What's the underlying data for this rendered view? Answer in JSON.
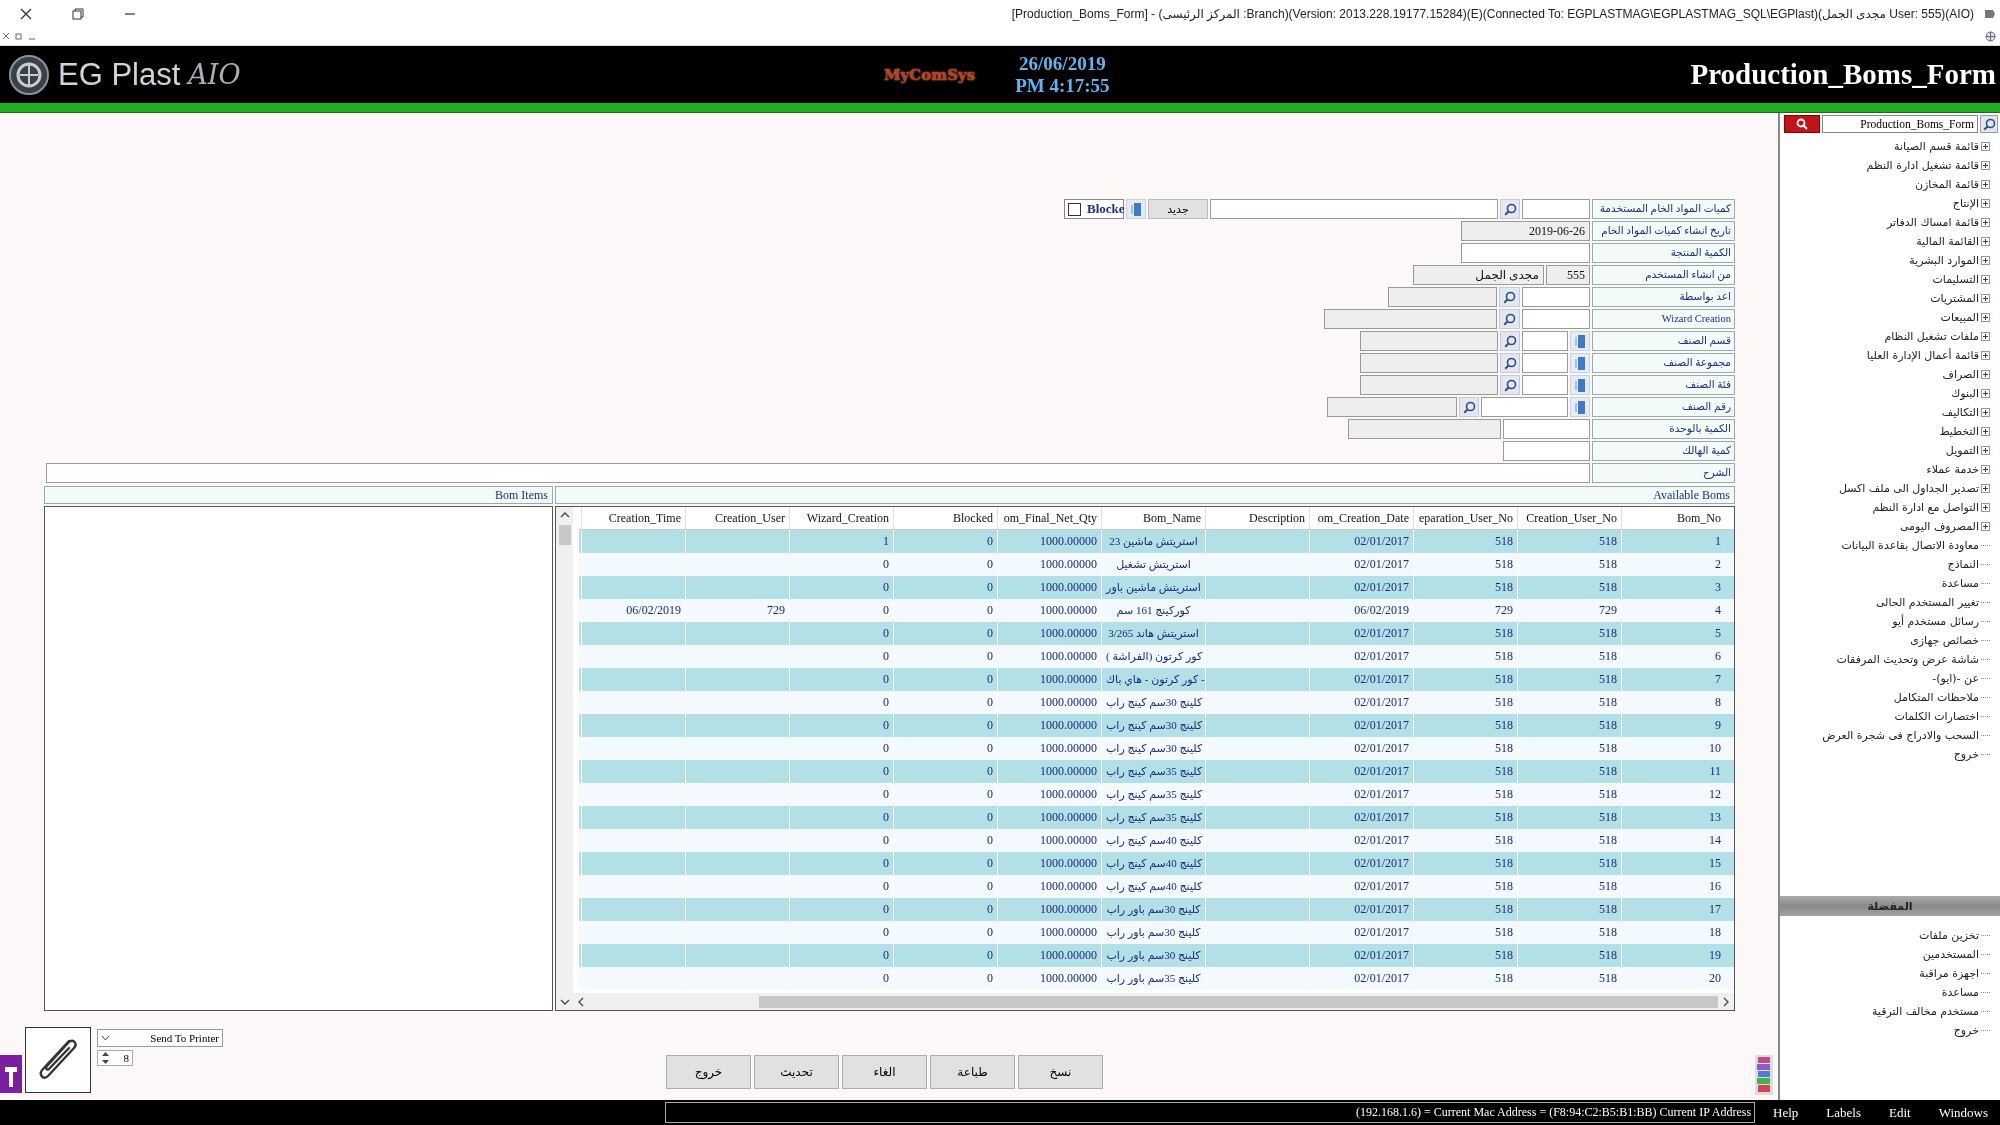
{
  "window": {
    "title": "[Production_Boms_Form] - (المركز الرئيسى :Branch)(Version: 2013.228.19177.15284)(E)(Connected To: EGPLASTMAG\\EGPLASTMAG_SQL\\EGPlast)(مجدى الجمل User: 555)(AIO)"
  },
  "header": {
    "logo_text": "EG Plast",
    "logo_suffix": "AIO",
    "vendor": "MyComSys",
    "date": "26/06/2019",
    "time": "PM 4:17:55",
    "form_title": "Production_Boms_Form"
  },
  "form": {
    "rows": [
      {
        "label": "كميات المواد الخام المستخدمة",
        "controls": [
          {
            "kind": "field",
            "disabled": false
          },
          {
            "kind": "search"
          },
          {
            "kind": "field",
            "disabled": false
          },
          {
            "kind": "new",
            "label": "جديد"
          },
          {
            "kind": "picker"
          },
          {
            "kind": "checkbox",
            "label": "Blocke",
            "checked": false
          }
        ]
      },
      {
        "label": "تاريخ انشاء كميات المواد الخام",
        "controls": [
          {
            "kind": "field",
            "disabled": true,
            "value": "2019-06-26"
          }
        ]
      },
      {
        "label": "الكمية المنتجة",
        "controls": [
          {
            "kind": "field",
            "disabled": false
          }
        ]
      },
      {
        "label": "من انشاء المستخدم",
        "controls": [
          {
            "kind": "field",
            "disabled": true,
            "value": "555"
          },
          {
            "kind": "field",
            "disabled": true,
            "value": "مجدى الجمل"
          }
        ]
      },
      {
        "label": "اعد بواسطة",
        "controls": [
          {
            "kind": "field",
            "disabled": false
          },
          {
            "kind": "search"
          },
          {
            "kind": "field",
            "disabled": true
          }
        ]
      },
      {
        "label": "Wizard Creation",
        "controls": [
          {
            "kind": "field",
            "disabled": false
          },
          {
            "kind": "search"
          },
          {
            "kind": "field",
            "disabled": true
          }
        ]
      },
      {
        "label": "قسم الصنف",
        "controls": [
          {
            "kind": "picker"
          },
          {
            "kind": "field",
            "disabled": false
          },
          {
            "kind": "search"
          },
          {
            "kind": "field",
            "disabled": true
          }
        ]
      },
      {
        "label": "مجموعة الصنف",
        "controls": [
          {
            "kind": "picker"
          },
          {
            "kind": "field",
            "disabled": false
          },
          {
            "kind": "search"
          },
          {
            "kind": "field",
            "disabled": true
          }
        ]
      },
      {
        "label": "فئة الصنف",
        "controls": [
          {
            "kind": "picker"
          },
          {
            "kind": "field",
            "disabled": false
          },
          {
            "kind": "search"
          },
          {
            "kind": "field",
            "disabled": true
          }
        ]
      },
      {
        "label": "رقم الصنف",
        "controls": [
          {
            "kind": "picker"
          },
          {
            "kind": "field",
            "disabled": false
          },
          {
            "kind": "search"
          },
          {
            "kind": "field",
            "disabled": true
          }
        ]
      },
      {
        "label": "الكمية بالوحدة",
        "controls": [
          {
            "kind": "field",
            "disabled": false
          },
          {
            "kind": "field",
            "disabled": true
          }
        ]
      },
      {
        "label": "كمية الهالك",
        "controls": [
          {
            "kind": "field",
            "disabled": false
          }
        ]
      },
      {
        "label": "الشرح",
        "controls": [
          {
            "kind": "field",
            "disabled": false
          }
        ]
      }
    ]
  },
  "bom_items": {
    "title": "Bom Items"
  },
  "available_boms": {
    "title": "Available Boms",
    "columns": [
      "Bom_No",
      "Creation_User_No",
      "eparation_User_No",
      "om_Creation_Date",
      "Description",
      "Bom_Name",
      "om_Final_Net_Qty",
      "Blocked",
      "Wizard_Creation",
      "Creation_User",
      "Creation_Time"
    ],
    "rows": [
      {
        "bom_no": "1",
        "creation_user_no": "518",
        "preparation_user_no": "518",
        "creation_date": "02/01/2017",
        "bom_name": "استريتش ماشين 23",
        "final_net_qty": "1000.00000",
        "blocked": "0",
        "wizard_creation": "1"
      },
      {
        "bom_no": "2",
        "creation_user_no": "518",
        "preparation_user_no": "518",
        "creation_date": "02/01/2017",
        "bom_name": "استريتش تشغيل",
        "final_net_qty": "1000.00000",
        "blocked": "0",
        "wizard_creation": "0"
      },
      {
        "bom_no": "3",
        "creation_user_no": "518",
        "preparation_user_no": "518",
        "creation_date": "02/01/2017",
        "bom_name": "استريتش ماشين باور",
        "final_net_qty": "1000.00000",
        "blocked": "0",
        "wizard_creation": "0"
      },
      {
        "bom_no": "4",
        "creation_user_no": "729",
        "preparation_user_no": "729",
        "creation_date": "06/02/2019",
        "bom_name": "كوركينج 161 سم",
        "final_net_qty": "1000.00000",
        "blocked": "0",
        "wizard_creation": "0",
        "creation_user": "729",
        "creation_time": "06/02/2019"
      },
      {
        "bom_no": "5",
        "creation_user_no": "518",
        "preparation_user_no": "518",
        "creation_date": "02/01/2017",
        "bom_name": "استريتش هاند 3/265",
        "final_net_qty": "1000.00000",
        "blocked": "0",
        "wizard_creation": "0"
      },
      {
        "bom_no": "6",
        "creation_user_no": "518",
        "preparation_user_no": "518",
        "creation_date": "02/01/2017",
        "bom_name": "كور كرتون (الفراشة )",
        "final_net_qty": "1000.00000",
        "blocked": "0",
        "wizard_creation": "0"
      },
      {
        "bom_no": "7",
        "creation_user_no": "518",
        "preparation_user_no": "518",
        "creation_date": "02/01/2017",
        "bom_name": "كور كرتون - هاي باك -",
        "final_net_qty": "1000.00000",
        "blocked": "0",
        "wizard_creation": "0"
      },
      {
        "bom_no": "8",
        "creation_user_no": "518",
        "preparation_user_no": "518",
        "creation_date": "02/01/2017",
        "bom_name": "كلينج 30سم كينج راب",
        "final_net_qty": "1000.00000",
        "blocked": "0",
        "wizard_creation": "0"
      },
      {
        "bom_no": "9",
        "creation_user_no": "518",
        "preparation_user_no": "518",
        "creation_date": "02/01/2017",
        "bom_name": "كلينج 30سم كينج راب",
        "final_net_qty": "1000.00000",
        "blocked": "0",
        "wizard_creation": "0"
      },
      {
        "bom_no": "10",
        "creation_user_no": "518",
        "preparation_user_no": "518",
        "creation_date": "02/01/2017",
        "bom_name": "كلينج 30سم كينج راب",
        "final_net_qty": "1000.00000",
        "blocked": "0",
        "wizard_creation": "0"
      },
      {
        "bom_no": "11",
        "creation_user_no": "518",
        "preparation_user_no": "518",
        "creation_date": "02/01/2017",
        "bom_name": "كلينج 35سم كينج راب",
        "final_net_qty": "1000.00000",
        "blocked": "0",
        "wizard_creation": "0"
      },
      {
        "bom_no": "12",
        "creation_user_no": "518",
        "preparation_user_no": "518",
        "creation_date": "02/01/2017",
        "bom_name": "كلينج 35سم كينج راب",
        "final_net_qty": "1000.00000",
        "blocked": "0",
        "wizard_creation": "0"
      },
      {
        "bom_no": "13",
        "creation_user_no": "518",
        "preparation_user_no": "518",
        "creation_date": "02/01/2017",
        "bom_name": "كلينج 35سم كينج راب",
        "final_net_qty": "1000.00000",
        "blocked": "0",
        "wizard_creation": "0"
      },
      {
        "bom_no": "14",
        "creation_user_no": "518",
        "preparation_user_no": "518",
        "creation_date": "02/01/2017",
        "bom_name": "كلينج 40سم كينج راب",
        "final_net_qty": "1000.00000",
        "blocked": "0",
        "wizard_creation": "0"
      },
      {
        "bom_no": "15",
        "creation_user_no": "518",
        "preparation_user_no": "518",
        "creation_date": "02/01/2017",
        "bom_name": "كلينج 40سم كينج راب",
        "final_net_qty": "1000.00000",
        "blocked": "0",
        "wizard_creation": "0"
      },
      {
        "bom_no": "16",
        "creation_user_no": "518",
        "preparation_user_no": "518",
        "creation_date": "02/01/2017",
        "bom_name": "كلينج 40سم كينج راب",
        "final_net_qty": "1000.00000",
        "blocked": "0",
        "wizard_creation": "0"
      },
      {
        "bom_no": "17",
        "creation_user_no": "518",
        "preparation_user_no": "518",
        "creation_date": "02/01/2017",
        "bom_name": "كلينج 30سم باور راب",
        "final_net_qty": "1000.00000",
        "blocked": "0",
        "wizard_creation": "0"
      },
      {
        "bom_no": "18",
        "creation_user_no": "518",
        "preparation_user_no": "518",
        "creation_date": "02/01/2017",
        "bom_name": "كلينج 30سم باور راب",
        "final_net_qty": "1000.00000",
        "blocked": "0",
        "wizard_creation": "0"
      },
      {
        "bom_no": "19",
        "creation_user_no": "518",
        "preparation_user_no": "518",
        "creation_date": "02/01/2017",
        "bom_name": "كلينج 30سم باور راب",
        "final_net_qty": "1000.00000",
        "blocked": "0",
        "wizard_creation": "0"
      },
      {
        "bom_no": "20",
        "creation_user_no": "518",
        "preparation_user_no": "518",
        "creation_date": "02/01/2017",
        "bom_name": "كلينج 35سم باور راب",
        "final_net_qty": "1000.00000",
        "blocked": "0",
        "wizard_creation": "0"
      }
    ]
  },
  "print": {
    "target": "Send To Printer",
    "copies": "8"
  },
  "buttons": [
    "نسخ",
    "طباعة",
    "الغاء",
    "تحديث",
    "خروج"
  ],
  "sidebar": {
    "search_value": "Production_Boms_Form",
    "items": [
      {
        "label": "قائمة قسم الصيانة",
        "kind": "folder"
      },
      {
        "label": "قائمة تشغيل ادارة النظم",
        "kind": "folder"
      },
      {
        "label": "قائمة المخازن",
        "kind": "folder"
      },
      {
        "label": "الإنتاج",
        "kind": "folder"
      },
      {
        "label": "قائمة امساك الدفاتر",
        "kind": "folder"
      },
      {
        "label": "القائمة المالية",
        "kind": "folder"
      },
      {
        "label": "الموارد البشرية",
        "kind": "folder"
      },
      {
        "label": "التسليمات",
        "kind": "folder"
      },
      {
        "label": "المشتريات",
        "kind": "folder"
      },
      {
        "label": "المبيعات",
        "kind": "folder"
      },
      {
        "label": "ملفات تشغيل النظام",
        "kind": "folder"
      },
      {
        "label": "قائمة أعمال الإدارة العليا",
        "kind": "folder"
      },
      {
        "label": "الصراف",
        "kind": "folder"
      },
      {
        "label": "البنوك",
        "kind": "folder"
      },
      {
        "label": "التكاليف",
        "kind": "folder"
      },
      {
        "label": "التخطيط",
        "kind": "folder"
      },
      {
        "label": "التمويل",
        "kind": "folder"
      },
      {
        "label": "خدمة عملاء",
        "kind": "folder"
      },
      {
        "label": "تصدير الجداول الى ملف اكسل",
        "kind": "folder"
      },
      {
        "label": "التواصل مع ادارة النظم",
        "kind": "folder"
      },
      {
        "label": "المصروف اليومى",
        "kind": "folder"
      },
      {
        "label": "معاودة الاتصال بقاعدة البيانات",
        "kind": "leaf"
      },
      {
        "label": "النماذج",
        "kind": "leaf"
      },
      {
        "label": "مساعدة",
        "kind": "leaf"
      },
      {
        "label": "تغيير المستخدم الحالى",
        "kind": "leaf"
      },
      {
        "label": "رسائل مستخدم أيو",
        "kind": "leaf"
      },
      {
        "label": "خصائص جهازى",
        "kind": "leaf"
      },
      {
        "label": "شاشة عرض وتحديث المرفقات",
        "kind": "leaf"
      },
      {
        "label": "عن -(ايو)-",
        "kind": "leaf"
      },
      {
        "label": "ملاحظات المتكامل",
        "kind": "leaf"
      },
      {
        "label": "اختصارات الكلمات",
        "kind": "leaf"
      },
      {
        "label": "السحب والادراج فى شجرة العرض",
        "kind": "leaf"
      },
      {
        "label": "خروج",
        "kind": "leaf"
      }
    ],
    "favorites_title": "المفضلة",
    "favorites": [
      "تخزين ملفات",
      "المستخدمين",
      "اجهزة مراقبة",
      "مساعدة",
      "مستخدم مخالف الترقية",
      "خروج"
    ]
  },
  "status_bar": {
    "text": "(192.168.1.6) = Current Mac Address = (F8:94:C2:B5:B1:BB) Current IP Address",
    "menu": [
      "Windows",
      "Edit",
      "Labels",
      "Help"
    ]
  }
}
